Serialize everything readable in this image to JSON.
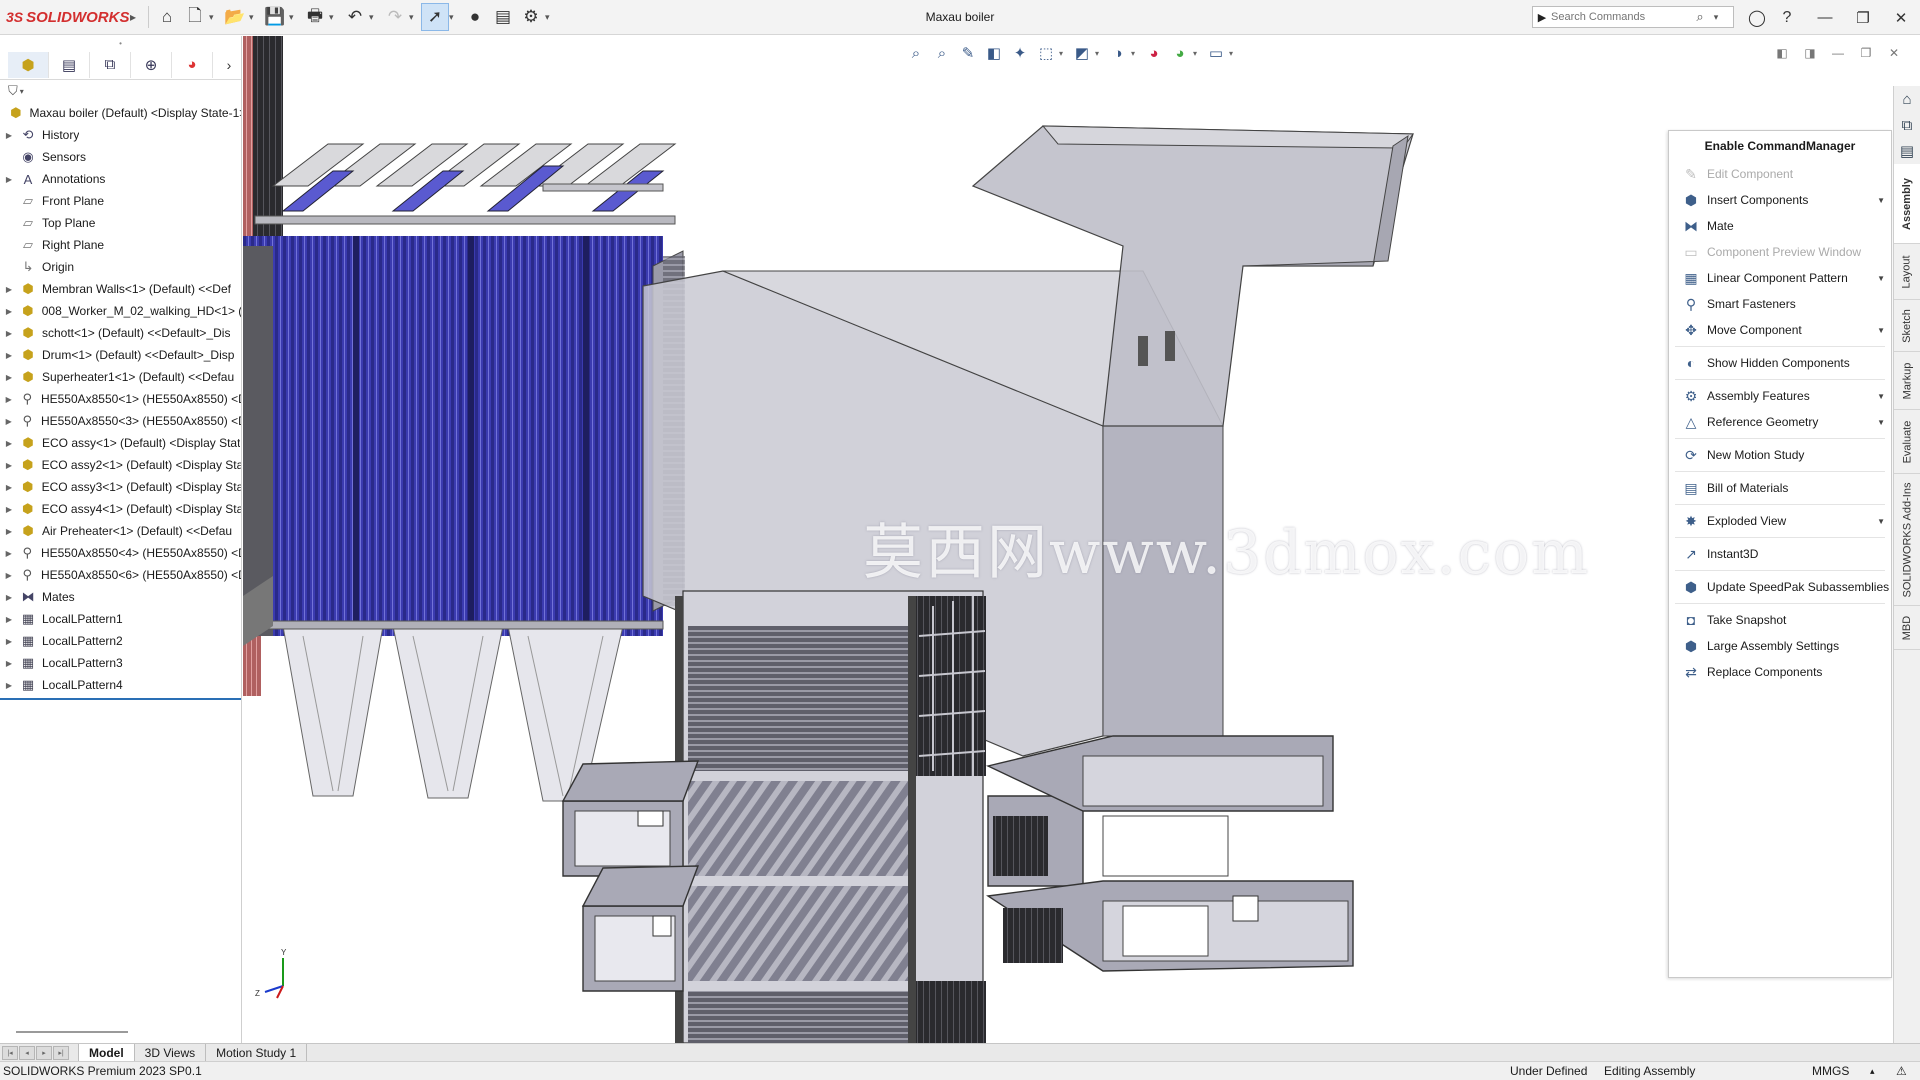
{
  "app": {
    "title": "Maxau boiler",
    "logo": "SOLIDWORKS"
  },
  "search": {
    "placeholder": "Search Commands"
  },
  "feature_tree": {
    "root": "Maxau boiler (Default) <Display State-1>",
    "items": [
      {
        "label": "History",
        "icon": "history-icon",
        "expandable": true
      },
      {
        "label": "Sensors",
        "icon": "sensor-icon",
        "expandable": false
      },
      {
        "label": "Annotations",
        "icon": "annotations-icon",
        "expandable": true
      },
      {
        "label": "Front Plane",
        "icon": "plane-icon",
        "expandable": false
      },
      {
        "label": "Top Plane",
        "icon": "plane-icon",
        "expandable": false
      },
      {
        "label": "Right Plane",
        "icon": "plane-icon",
        "expandable": false
      },
      {
        "label": "Origin",
        "icon": "origin-icon",
        "expandable": false
      },
      {
        "label": "Membran Walls<1> (Default) <<Def",
        "icon": "assembly-icon",
        "expandable": true
      },
      {
        "label": "008_Worker_M_02_walking_HD<1> (",
        "icon": "assembly-icon",
        "expandable": true
      },
      {
        "label": "schott<1> (Default) <<Default>_Dis",
        "icon": "assembly-icon",
        "expandable": true
      },
      {
        "label": "Drum<1> (Default) <<Default>_Disp",
        "icon": "assembly-icon",
        "expandable": true
      },
      {
        "label": "Superheater1<1> (Default) <<Defau",
        "icon": "assembly-icon",
        "expandable": true
      },
      {
        "label": "HE550Ax8550<1> (HE550Ax8550) <D",
        "icon": "bolt-icon",
        "expandable": true
      },
      {
        "label": "HE550Ax8550<3> (HE550Ax8550) <D",
        "icon": "bolt-icon",
        "expandable": true
      },
      {
        "label": "ECO assy<1> (Default) <Display Stat",
        "icon": "assembly-icon",
        "expandable": true
      },
      {
        "label": "ECO assy2<1> (Default) <Display Sta",
        "icon": "assembly-icon",
        "expandable": true
      },
      {
        "label": "ECO assy3<1> (Default) <Display Sta",
        "icon": "assembly-icon",
        "expandable": true
      },
      {
        "label": "ECO assy4<1> (Default) <Display Sta",
        "icon": "assembly-icon",
        "expandable": true
      },
      {
        "label": "Air Preheater<1> (Default) <<Defau",
        "icon": "assembly-icon",
        "expandable": true
      },
      {
        "label": "HE550Ax8550<4> (HE550Ax8550) <D",
        "icon": "bolt-icon",
        "expandable": true
      },
      {
        "label": "HE550Ax8550<6> (HE550Ax8550) <D",
        "icon": "bolt-icon",
        "expandable": true
      },
      {
        "label": "Mates",
        "icon": "mates-icon",
        "expandable": true
      },
      {
        "label": "LocalLPattern1",
        "icon": "pattern-icon",
        "expandable": true
      },
      {
        "label": "LocalLPattern2",
        "icon": "pattern-icon",
        "expandable": true
      },
      {
        "label": "LocalLPattern3",
        "icon": "pattern-icon",
        "expandable": true
      },
      {
        "label": "LocalLPattern4",
        "icon": "pattern-icon",
        "expandable": true
      }
    ]
  },
  "command_manager": {
    "title": "Enable CommandManager",
    "items": [
      {
        "label": "Edit Component",
        "disabled": true,
        "dropdown": false,
        "icon": "edit-component-icon"
      },
      {
        "label": "Insert Components",
        "disabled": false,
        "dropdown": true,
        "icon": "insert-components-icon"
      },
      {
        "label": "Mate",
        "disabled": false,
        "dropdown": false,
        "icon": "mate-icon"
      },
      {
        "label": "Component Preview Window",
        "disabled": true,
        "dropdown": false,
        "icon": "preview-window-icon"
      },
      {
        "label": "Linear Component Pattern",
        "disabled": false,
        "dropdown": true,
        "icon": "linear-pattern-icon"
      },
      {
        "label": "Smart Fasteners",
        "disabled": false,
        "dropdown": false,
        "icon": "smart-fasteners-icon"
      },
      {
        "label": "Move Component",
        "disabled": false,
        "dropdown": true,
        "icon": "move-component-icon",
        "sep_after": true
      },
      {
        "label": "Show Hidden Components",
        "disabled": false,
        "dropdown": false,
        "icon": "show-hidden-icon",
        "sep_after": true
      },
      {
        "label": "Assembly Features",
        "disabled": false,
        "dropdown": true,
        "icon": "assembly-features-icon"
      },
      {
        "label": "Reference Geometry",
        "disabled": false,
        "dropdown": true,
        "icon": "reference-geometry-icon",
        "sep_after": true
      },
      {
        "label": "New Motion Study",
        "disabled": false,
        "dropdown": false,
        "icon": "motion-study-icon",
        "sep_after": true
      },
      {
        "label": "Bill of Materials",
        "disabled": false,
        "dropdown": false,
        "icon": "bom-icon",
        "sep_after": true
      },
      {
        "label": "Exploded View",
        "disabled": false,
        "dropdown": true,
        "icon": "exploded-view-icon",
        "sep_after": true
      },
      {
        "label": "Instant3D",
        "disabled": false,
        "dropdown": false,
        "icon": "instant3d-icon",
        "sep_after": true
      },
      {
        "label": "Update SpeedPak Subassemblies",
        "disabled": false,
        "dropdown": false,
        "icon": "speedpak-icon",
        "sep_after": true
      },
      {
        "label": "Take Snapshot",
        "disabled": false,
        "dropdown": false,
        "icon": "snapshot-icon"
      },
      {
        "label": "Large Assembly Settings",
        "disabled": false,
        "dropdown": false,
        "icon": "large-assembly-icon"
      },
      {
        "label": "Replace Components",
        "disabled": false,
        "dropdown": false,
        "icon": "replace-components-icon"
      }
    ]
  },
  "right_tabs": [
    {
      "label": "Assembly",
      "active": true
    },
    {
      "label": "Layout",
      "active": false
    },
    {
      "label": "Sketch",
      "active": false
    },
    {
      "label": "Markup",
      "active": false
    },
    {
      "label": "Evaluate",
      "active": false
    },
    {
      "label": "SOLIDWORKS Add-Ins",
      "active": false
    },
    {
      "label": "MBD",
      "active": false
    }
  ],
  "bottom_tabs": [
    {
      "label": "Model",
      "active": true
    },
    {
      "label": "3D Views",
      "active": false
    },
    {
      "label": "Motion Study 1",
      "active": false
    }
  ],
  "watermark": "莫西网www.3dmox.com",
  "status": {
    "product": "SOLIDWORKS Premium 2023 SP0.1",
    "definition": "Under Defined",
    "mode": "Editing Assembly",
    "units": "MMGS"
  },
  "colors": {
    "accent": "#2a6fb5",
    "tube_blue": "#3b3bb0",
    "steel": "#8e8ea0",
    "logo_red": "#d32f2f"
  }
}
